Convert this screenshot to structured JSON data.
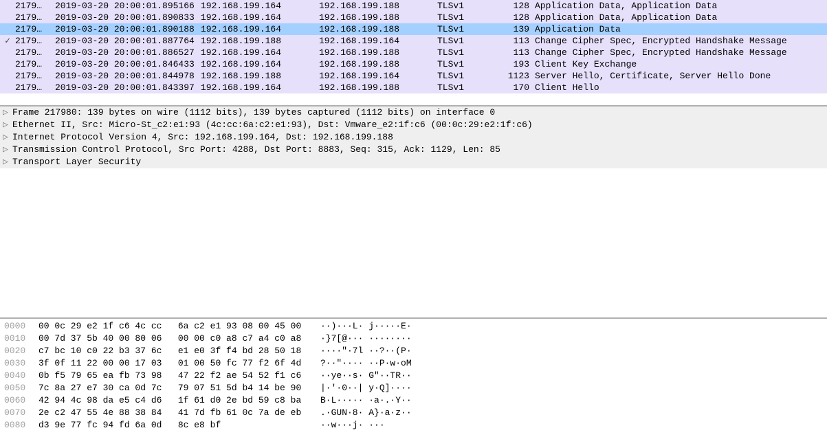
{
  "packets": [
    {
      "mark": "",
      "no": "2179…",
      "time": "2019-03-20 20:00:01.895166",
      "src": "192.168.199.164",
      "dst": "192.168.199.188",
      "proto": "TLSv1",
      "len": "128",
      "info": "Application Data, Application Data",
      "cls": "lavender"
    },
    {
      "mark": "",
      "no": "2179…",
      "time": "2019-03-20 20:00:01.890833",
      "src": "192.168.199.164",
      "dst": "192.168.199.188",
      "proto": "TLSv1",
      "len": "128",
      "info": "Application Data, Application Data",
      "cls": "lavender"
    },
    {
      "mark": "",
      "no": "2179…",
      "time": "2019-03-20 20:00:01.890188",
      "src": "192.168.199.164",
      "dst": "192.168.199.188",
      "proto": "TLSv1",
      "len": "139",
      "info": "Application Data",
      "cls": "selected"
    },
    {
      "mark": "✓",
      "no": "2179…",
      "time": "2019-03-20 20:00:01.887764",
      "src": "192.168.199.188",
      "dst": "192.168.199.164",
      "proto": "TLSv1",
      "len": "113",
      "info": "Change Cipher Spec, Encrypted Handshake Message",
      "cls": "lavender"
    },
    {
      "mark": "",
      "no": "2179…",
      "time": "2019-03-20 20:00:01.886527",
      "src": "192.168.199.164",
      "dst": "192.168.199.188",
      "proto": "TLSv1",
      "len": "113",
      "info": "Change Cipher Spec, Encrypted Handshake Message",
      "cls": "lavender"
    },
    {
      "mark": "",
      "no": "2179…",
      "time": "2019-03-20 20:00:01.846433",
      "src": "192.168.199.164",
      "dst": "192.168.199.188",
      "proto": "TLSv1",
      "len": "193",
      "info": "Client Key Exchange",
      "cls": "lavender"
    },
    {
      "mark": "",
      "no": "2179…",
      "time": "2019-03-20 20:00:01.844978",
      "src": "192.168.199.188",
      "dst": "192.168.199.164",
      "proto": "TLSv1",
      "len": "1123",
      "info": "Server Hello, Certificate, Server Hello Done",
      "cls": "lavender"
    },
    {
      "mark": "",
      "no": "2179…",
      "time": "2019-03-20 20:00:01.843397",
      "src": "192.168.199.164",
      "dst": "192.168.199.188",
      "proto": "TLSv1",
      "len": "170",
      "info": "Client Hello",
      "cls": "lavender"
    }
  ],
  "details": [
    "Frame 217980: 139 bytes on wire (1112 bits), 139 bytes captured (1112 bits) on interface 0",
    "Ethernet II, Src: Micro-St_c2:e1:93 (4c:cc:6a:c2:e1:93), Dst: Vmware_e2:1f:c6 (00:0c:29:e2:1f:c6)",
    "Internet Protocol Version 4, Src: 192.168.199.164, Dst: 192.168.199.188",
    "Transmission Control Protocol, Src Port: 4288, Dst Port: 8883, Seq: 315, Ack: 1129, Len: 85",
    "Transport Layer Security"
  ],
  "hex": [
    {
      "off": "0000",
      "b": "00 0c 29 e2 1f c6 4c cc   6a c2 e1 93 08 00 45 00",
      "a": "··)···L· j·····E·"
    },
    {
      "off": "0010",
      "b": "00 7d 37 5b 40 00 80 06   00 00 c0 a8 c7 a4 c0 a8",
      "a": "·}7[@··· ········"
    },
    {
      "off": "0020",
      "b": "c7 bc 10 c0 22 b3 37 6c   e1 e0 3f f4 bd 28 50 18",
      "a": "····\"·7l ··?··(P·"
    },
    {
      "off": "0030",
      "b": "3f 0f 11 22 00 00 17 03   01 00 50 fc 77 f2 6f 4d",
      "a": "?··\"···· ··P·w·oM"
    },
    {
      "off": "0040",
      "b": "0b f5 79 65 ea fb 73 98   47 22 f2 ae 54 52 f1 c6",
      "a": "··ye··s· G\"··TR··"
    },
    {
      "off": "0050",
      "b": "7c 8a 27 e7 30 ca 0d 7c   79 07 51 5d b4 14 be 90",
      "a": "|·'·0··| y·Q]····"
    },
    {
      "off": "0060",
      "b": "42 94 4c 98 da e5 c4 d6   1f 61 d0 2e bd 59 c8 ba",
      "a": "B·L····· ·a·.·Y··"
    },
    {
      "off": "0070",
      "b": "2e c2 47 55 4e 88 38 84   41 7d fb 61 0c 7a de eb",
      "a": ".·GUN·8· A}·a·z··"
    },
    {
      "off": "0080",
      "b": "d3 9e 77 fc 94 fd 6a 0d   8c e8 bf",
      "a": "··w···j· ···"
    }
  ]
}
